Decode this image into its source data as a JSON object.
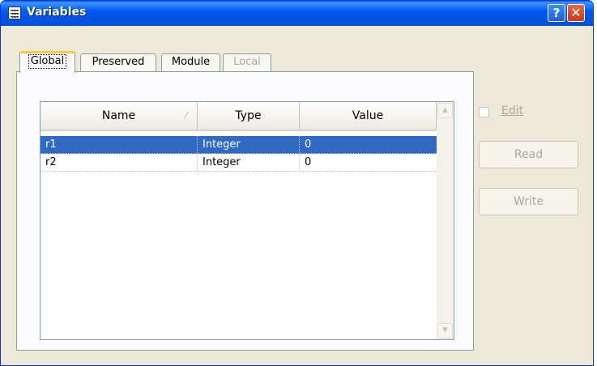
{
  "window": {
    "title": "Variables"
  },
  "title_buttons": {
    "help": "?",
    "close": "✕"
  },
  "tabs": [
    {
      "label": "Global",
      "active": true,
      "enabled": true
    },
    {
      "label": "Preserved",
      "active": false,
      "enabled": true
    },
    {
      "label": "Module",
      "active": false,
      "enabled": true
    },
    {
      "label": "Local",
      "active": false,
      "enabled": false
    }
  ],
  "table": {
    "columns": [
      "Name",
      "Type",
      "Value"
    ],
    "sort_column": "Name",
    "rows": [
      {
        "name": "r1",
        "type": "Integer",
        "value": "0",
        "selected": true
      },
      {
        "name": "r2",
        "type": "Integer",
        "value": "0",
        "selected": false
      }
    ]
  },
  "controls": {
    "edit_checkbox": {
      "label": "Edit",
      "checked": false,
      "enabled": false
    },
    "read_button": {
      "label": "Read",
      "enabled": false
    },
    "write_button": {
      "label": "Write",
      "enabled": false
    }
  },
  "icons": {
    "window": "variables-window-icon",
    "sort": "sort-ascending-icon",
    "scroll_up": "scroll-up-arrow-icon",
    "scroll_down": "scroll-down-arrow-icon"
  },
  "colors": {
    "titlebar": "#0054e3",
    "selection": "#316ac5",
    "active_tab_highlight": "#ffc83c",
    "disabled_text": "#aca899"
  }
}
